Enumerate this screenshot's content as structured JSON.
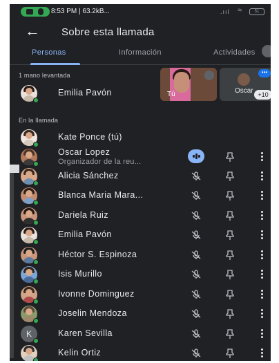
{
  "status_bar": {
    "text": "8:53 PM | 63.2kB...",
    "signal": ".ııl",
    "wifi": "≈",
    "battery": "51"
  },
  "header": {
    "back_icon": "arrow-back-icon",
    "title": "Sobre esta llamada"
  },
  "tabs": [
    {
      "label": "Personas",
      "active": true
    },
    {
      "label": "Información",
      "active": false
    },
    {
      "label": "Actividades",
      "active": false
    }
  ],
  "raised_hands": {
    "label": "1 mano levantada",
    "participant": "Emilia Pavón"
  },
  "tiles": {
    "self_label": "Tú",
    "other_label": "Oscar",
    "more_count": "+10",
    "more_dots": "•••"
  },
  "in_call": {
    "label": "En la llamada",
    "participants": [
      {
        "name": "Kate Ponce (tú)",
        "subtitle": "",
        "controls": false
      },
      {
        "name": "Oscar Lopez",
        "subtitle": "Organizador de la reu...",
        "controls": true,
        "speaking": true
      },
      {
        "name": "Alicia Sánchez",
        "subtitle": "",
        "controls": true,
        "speaking": false
      },
      {
        "name": "Blanca Maria Mara...",
        "subtitle": "",
        "controls": true,
        "speaking": false
      },
      {
        "name": "Dariela Ruiz",
        "subtitle": "",
        "controls": true,
        "speaking": false
      },
      {
        "name": "Emilia Pavón",
        "subtitle": "",
        "controls": true,
        "speaking": false
      },
      {
        "name": "Héctor S. Espinoza",
        "subtitle": "",
        "controls": true,
        "speaking": false
      },
      {
        "name": "Isis Murillo",
        "subtitle": "",
        "controls": true,
        "speaking": false
      },
      {
        "name": "Ivonne Dominguez",
        "subtitle": "",
        "controls": true,
        "speaking": false
      },
      {
        "name": "Joselin Mendoza",
        "subtitle": "",
        "controls": true,
        "speaking": false
      },
      {
        "name": "Karen Sevilla",
        "subtitle": "",
        "controls": true,
        "speaking": false,
        "initial": "K"
      },
      {
        "name": "Kelin Ortiz",
        "subtitle": "",
        "controls": true,
        "speaking": false
      }
    ]
  },
  "colors": {
    "background": "#202124",
    "accent": "#8ab4f8",
    "online": "#34a853",
    "text": "#e8eaed",
    "muted": "#9aa0a6"
  }
}
